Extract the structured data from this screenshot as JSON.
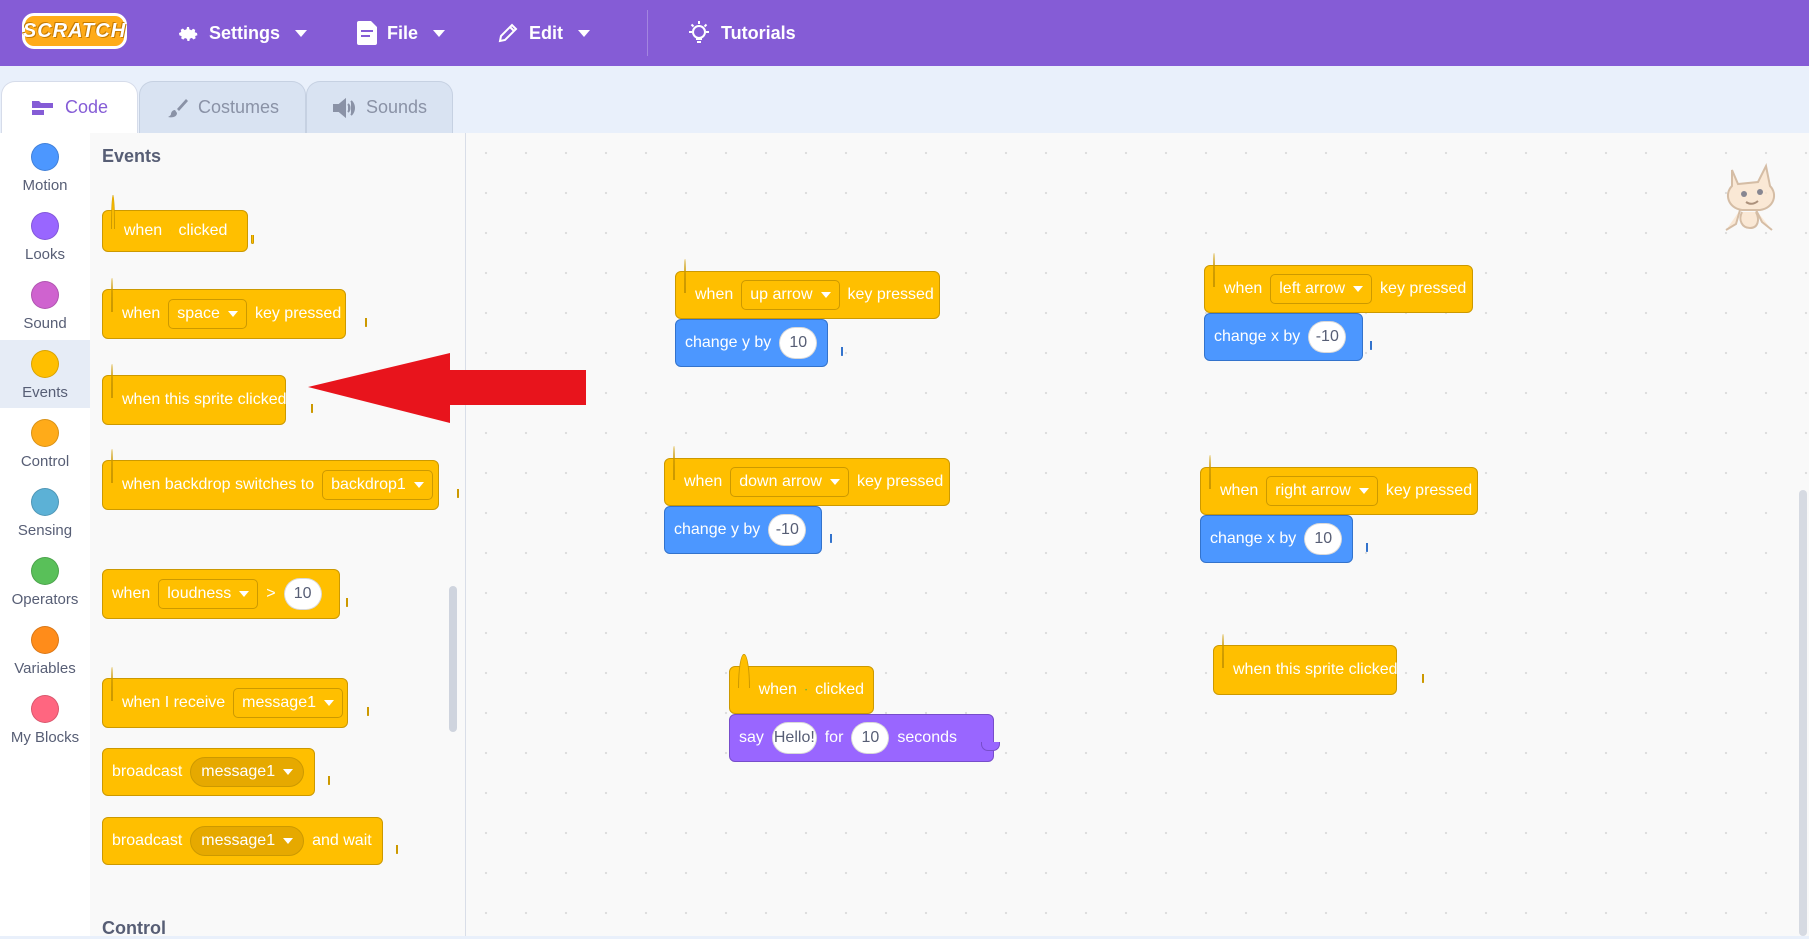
{
  "menubar": {
    "logo_text": "SCRATCH",
    "settings_label": "Settings",
    "file_label": "File",
    "edit_label": "Edit",
    "tutorials_label": "Tutorials"
  },
  "tabs": {
    "code_label": "Code",
    "costumes_label": "Costumes",
    "sounds_label": "Sounds",
    "active": "Code"
  },
  "categories": [
    {
      "label": "Motion",
      "color": "#4c97ff"
    },
    {
      "label": "Looks",
      "color": "#9966ff"
    },
    {
      "label": "Sound",
      "color": "#cf63cf"
    },
    {
      "label": "Events",
      "color": "#ffbf00",
      "selected": true
    },
    {
      "label": "Control",
      "color": "#ffab19"
    },
    {
      "label": "Sensing",
      "color": "#5cb1d6"
    },
    {
      "label": "Operators",
      "color": "#59c059"
    },
    {
      "label": "Variables",
      "color": "#ff8c1a"
    },
    {
      "label": "My Blocks",
      "color": "#ff6680"
    }
  ],
  "palette": {
    "events_header": "Events",
    "control_header": "Control",
    "b1": {
      "when": "when",
      "clicked": "clicked"
    },
    "b2": {
      "when": "when",
      "key": "space",
      "suffix": "key pressed"
    },
    "b3": {
      "text": "when this sprite clicked"
    },
    "b4": {
      "text": "when backdrop switches to",
      "backdrop": "backdrop1"
    },
    "b5": {
      "when": "when",
      "option": "loudness",
      "op": ">",
      "value": "10"
    },
    "b6": {
      "text": "when I receive",
      "message": "message1"
    },
    "b7": {
      "text": "broadcast",
      "message": "message1"
    },
    "b8": {
      "text": "broadcast",
      "message": "message1",
      "suffix": "and wait"
    }
  },
  "workspace": {
    "s1": {
      "when": "when",
      "key": "up arrow",
      "suffix": "key pressed",
      "action": "change y by",
      "value": "10"
    },
    "s2": {
      "when": "when",
      "key": "down arrow",
      "suffix": "key pressed",
      "action": "change y by",
      "value": "-10"
    },
    "s3": {
      "when": "when",
      "key": "left arrow",
      "suffix": "key pressed",
      "action": "change x by",
      "value": "-10"
    },
    "s4": {
      "when": "when",
      "key": "right arrow",
      "suffix": "key pressed",
      "action": "change x by",
      "value": "10"
    },
    "s5": {
      "when": "when",
      "clicked": "clicked",
      "say": "say",
      "message": "Hello!",
      "for": "for",
      "secs": "10",
      "seconds": "seconds"
    },
    "s6": {
      "text": "when this sprite clicked"
    }
  },
  "colors": {
    "menubar": "#855cd6",
    "events": "#ffbf00",
    "motion": "#4c97ff",
    "looks": "#9966ff",
    "annotation_arrow": "#e8141c"
  }
}
